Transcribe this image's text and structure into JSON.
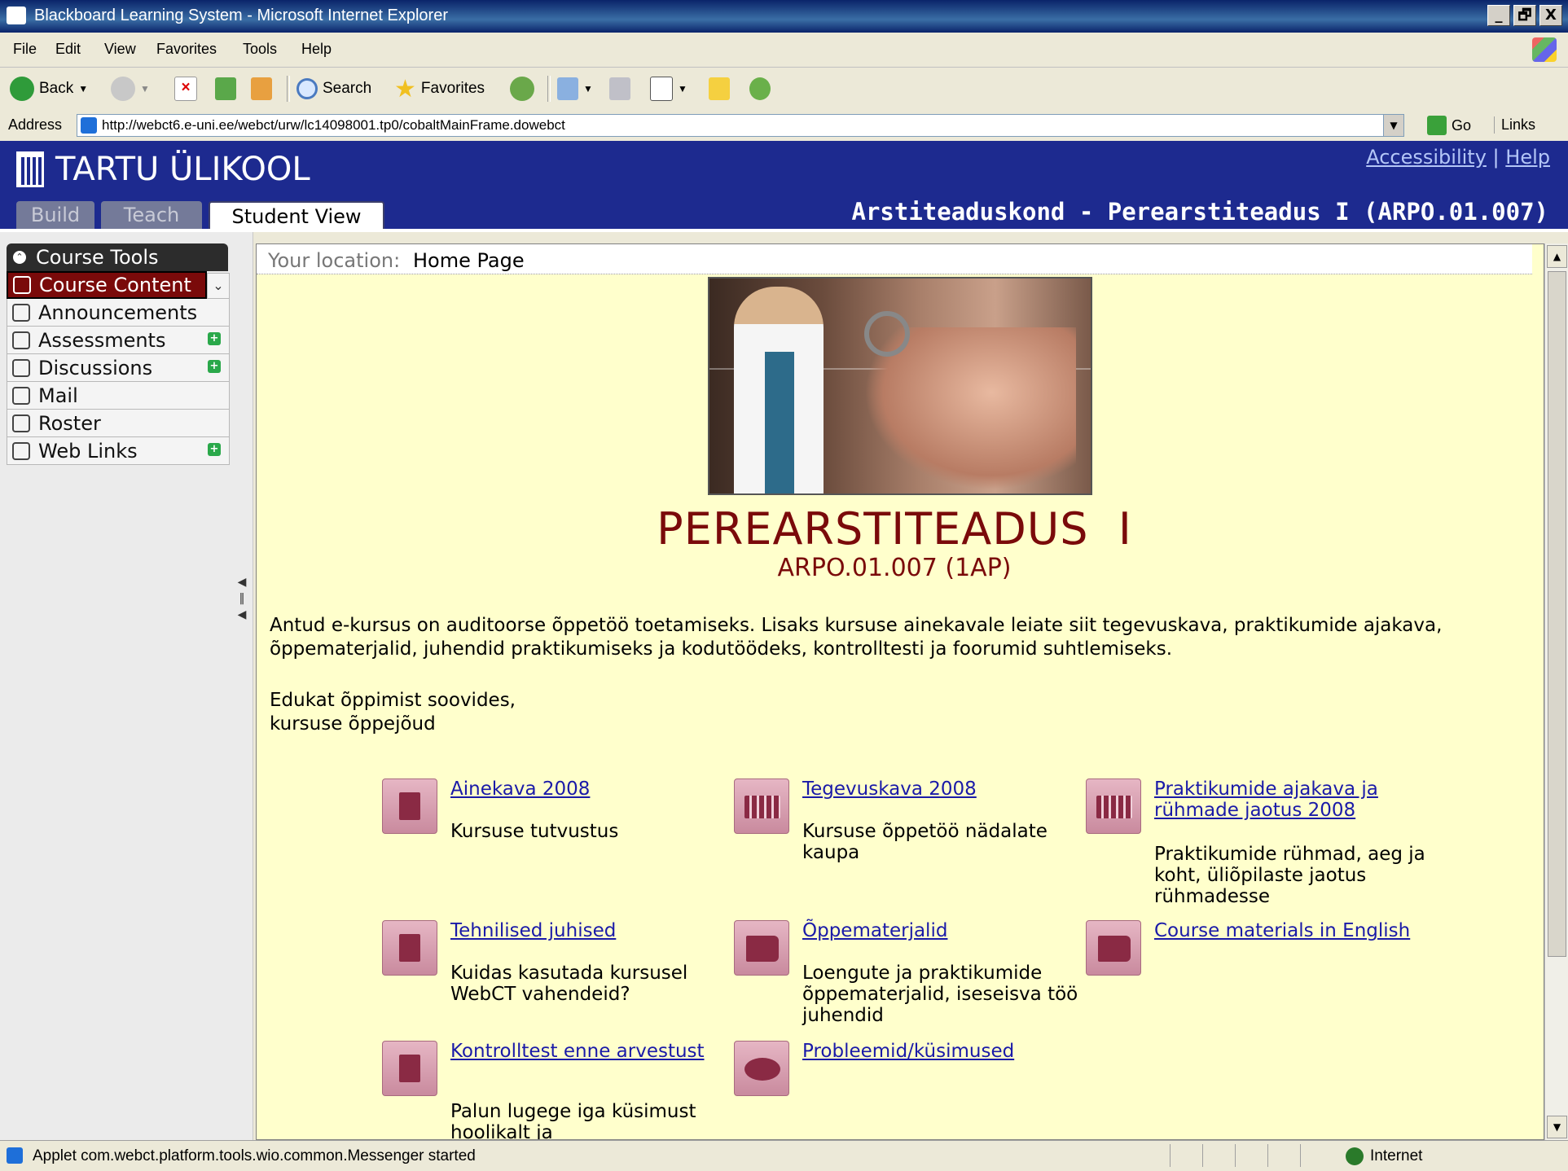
{
  "window": {
    "title": "Blackboard Learning System - Microsoft Internet Explorer",
    "controls": [
      "_",
      "🗗",
      "X"
    ]
  },
  "menubar": [
    "File",
    "Edit",
    "View",
    "Favorites",
    "Tools",
    "Help"
  ],
  "toolbar": {
    "back": "Back",
    "search": "Search",
    "favorites": "Favorites"
  },
  "address": {
    "label": "Address",
    "url": "http://webct6.e-uni.ee/webct/urw/lc14098001.tp0/cobaltMainFrame.dowebct",
    "go": "Go",
    "links": "Links"
  },
  "banner": {
    "logo": "TARTU ÜLIKOOL",
    "accessibility": "Accessibility",
    "separator": "|",
    "help": "Help",
    "tabs": [
      "Build",
      "Teach",
      "Student View"
    ],
    "active_tab": "Student View",
    "course_title": "Arstiteaduskond - Perearstiteadus I (ARPO.01.007)"
  },
  "sidebar": {
    "heading": "Course Tools",
    "items": [
      {
        "label": "Course Content",
        "icon": "home-icon",
        "selected": true
      },
      {
        "label": "Announcements",
        "icon": "megaphone-icon"
      },
      {
        "label": "Assessments",
        "icon": "assessment-icon",
        "has_new": true
      },
      {
        "label": "Discussions",
        "icon": "pin-icon",
        "has_new": true
      },
      {
        "label": "Mail",
        "icon": "mail-icon"
      },
      {
        "label": "Roster",
        "icon": "people-icon"
      },
      {
        "label": "Web Links",
        "icon": "globe-icon",
        "has_new": true
      }
    ]
  },
  "location": {
    "label": "Your location:",
    "value": "Home Page"
  },
  "course": {
    "title": "PEREARSTITEADUS  I",
    "code": "ARPO.01.007 (1AP)",
    "intro": "Antud e-kursus on auditoorse õppetöö toetamiseks. Lisaks kursuse ainekavale leiate siit tegevuskava, praktikumide ajakava, õppematerjalid, juhendid praktikumiseks ja kodutöödeks, kontrolltesti ja foorumid suhtlemiseks.",
    "greeting_1": "Edukat õppimist soovides,",
    "greeting_2": "kursuse õppejõud"
  },
  "items": [
    {
      "link": "Ainekava 2008",
      "desc": "Kursuse tutvustus",
      "icon": "document-icon"
    },
    {
      "link": "Tegevuskava 2008",
      "desc": "Kursuse õppetöö nädalate kaupa",
      "icon": "calendar-icon"
    },
    {
      "link": "Praktikumide ajakava ja rühmade jaotus 2008",
      "desc": "Praktikumide rühmad, aeg ja koht, üliõpilaste jaotus rühmadesse",
      "icon": "calendar-icon"
    },
    {
      "link": "Tehnilised juhised",
      "desc": "Kuidas kasutada kursusel WebCT vahendeid?",
      "icon": "page-icon"
    },
    {
      "link": "Õppematerjalid",
      "desc": "Loengute ja praktikumide õppematerjalid, iseseisva töö juhendid",
      "icon": "book-icon"
    },
    {
      "link": "Course materials in English",
      "desc": "",
      "icon": "book-icon"
    },
    {
      "link": "Kontrolltest enne arvestust",
      "desc": "Palun lugege iga küsimust hoolikalt ja",
      "icon": "test-icon"
    },
    {
      "link": "Probleemid/küsimused",
      "desc": "",
      "icon": "chat-icon"
    }
  ],
  "status": {
    "text": "Applet com.webct.platform.tools.wio.common.Messenger started",
    "zone": "Internet"
  }
}
